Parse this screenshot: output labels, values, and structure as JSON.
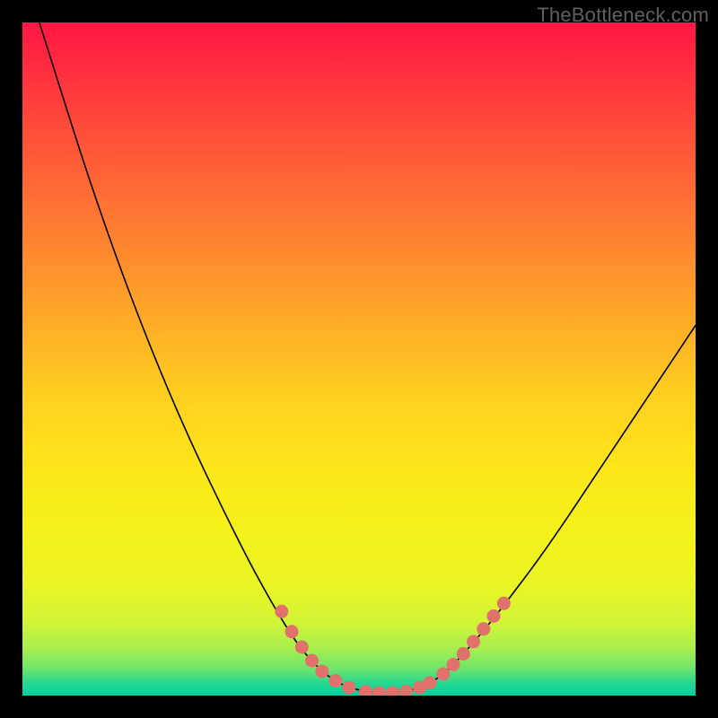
{
  "watermark": "TheBottleneck.com",
  "chart_data": {
    "type": "line",
    "title": "",
    "xlabel": "",
    "ylabel": "",
    "xlim": [
      0,
      100
    ],
    "ylim": [
      0,
      100
    ],
    "series": [
      {
        "name": "curve",
        "points": [
          {
            "x": 2.5,
            "y": 100
          },
          {
            "x": 12,
            "y": 70
          },
          {
            "x": 22,
            "y": 44
          },
          {
            "x": 32,
            "y": 23
          },
          {
            "x": 38,
            "y": 12
          },
          {
            "x": 42,
            "y": 6
          },
          {
            "x": 46,
            "y": 2.3
          },
          {
            "x": 49,
            "y": 1.0
          },
          {
            "x": 52,
            "y": 0.5
          },
          {
            "x": 55,
            "y": 0.4
          },
          {
            "x": 58,
            "y": 0.8
          },
          {
            "x": 61,
            "y": 2.0
          },
          {
            "x": 64,
            "y": 4.5
          },
          {
            "x": 68,
            "y": 9
          },
          {
            "x": 72,
            "y": 14
          },
          {
            "x": 78,
            "y": 22
          },
          {
            "x": 86,
            "y": 34
          },
          {
            "x": 94,
            "y": 46
          },
          {
            "x": 100,
            "y": 55
          }
        ]
      },
      {
        "name": "highlighted-dots",
        "points": [
          {
            "x": 38.5,
            "y": 12.5
          },
          {
            "x": 40.0,
            "y": 9.5
          },
          {
            "x": 41.5,
            "y": 7.2
          },
          {
            "x": 43.0,
            "y": 5.2
          },
          {
            "x": 44.5,
            "y": 3.6
          },
          {
            "x": 46.5,
            "y": 2.2
          },
          {
            "x": 48.5,
            "y": 1.2
          },
          {
            "x": 51.0,
            "y": 0.6
          },
          {
            "x": 53.0,
            "y": 0.4
          },
          {
            "x": 55.0,
            "y": 0.4
          },
          {
            "x": 57.0,
            "y": 0.6
          },
          {
            "x": 59.0,
            "y": 1.2
          },
          {
            "x": 60.5,
            "y": 1.9
          },
          {
            "x": 62.5,
            "y": 3.2
          },
          {
            "x": 64.0,
            "y": 4.6
          },
          {
            "x": 65.5,
            "y": 6.2
          },
          {
            "x": 67.0,
            "y": 8.0
          },
          {
            "x": 68.5,
            "y": 9.9
          },
          {
            "x": 70.0,
            "y": 11.8
          },
          {
            "x": 71.5,
            "y": 13.7
          }
        ]
      }
    ],
    "dot_color": "#e0726b"
  }
}
